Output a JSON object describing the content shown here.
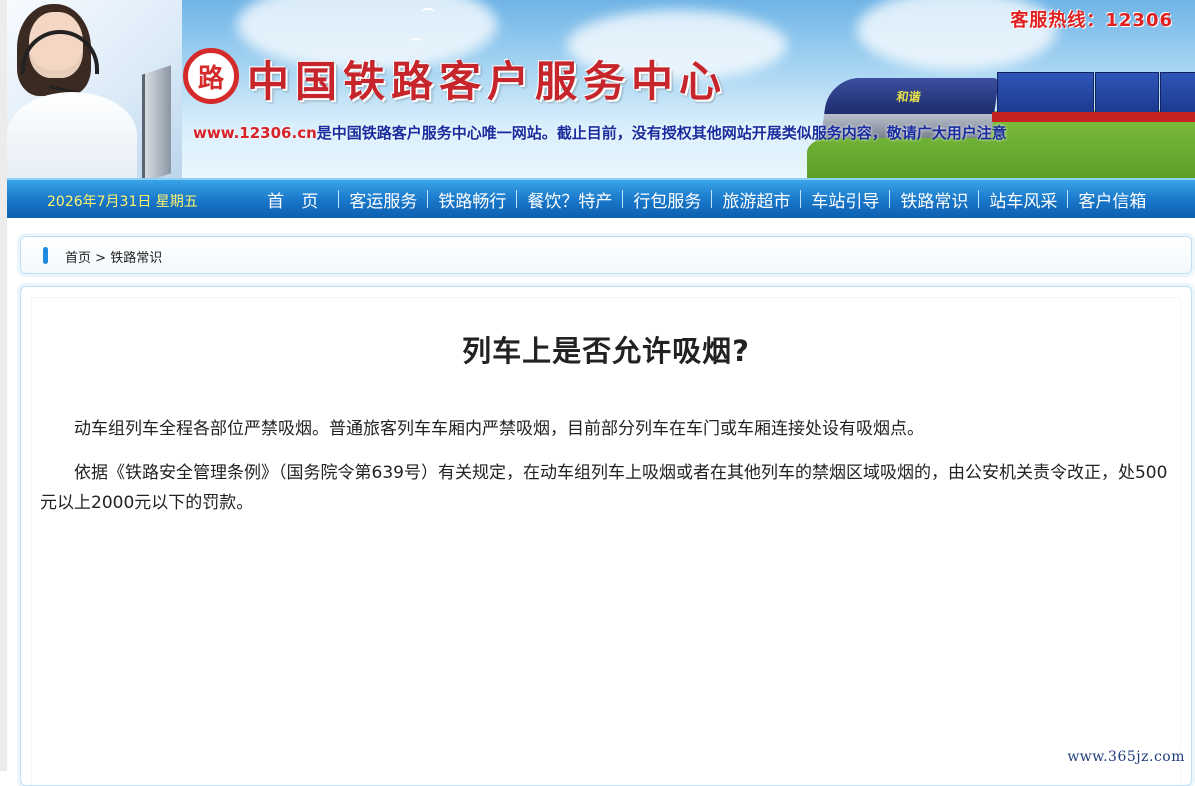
{
  "header": {
    "site_title": "中国铁路客户服务中心",
    "logo_glyph": "路",
    "hotline": "客服热线：12306",
    "notice_url": "www.12306.cn",
    "notice_text": "是中国铁路客户服务中心唯一网站。截止目前，没有授权其他网站开展类似服务内容，敬请广大用户注意"
  },
  "nav": {
    "date": "2026年7月31日 星期五",
    "items": [
      "首 页",
      "客运服务",
      "铁路畅行",
      "餐饮？特产",
      "行包服务",
      "旅游超市",
      "车站引导",
      "铁路常识",
      "站车风采",
      "客户信箱"
    ]
  },
  "breadcrumb": {
    "home": "首页",
    "separator": " > ",
    "current": "铁路常识"
  },
  "article": {
    "title": "列车上是否允许吸烟?",
    "paragraphs": [
      "动车组列车全程各部位严禁吸烟。普通旅客列车车厢内严禁吸烟，目前部分列车在车门或车厢连接处设有吸烟点。",
      "依据《铁路安全管理条例》（国务院令第639号）有关规定，在动车组列车上吸烟或者在其他列车的禁烟区域吸烟的，由公安机关责令改正，处500元以上2000元以下的罚款。"
    ]
  },
  "watermark": "www.365jz.com",
  "colors": {
    "title_red": "#c6262b",
    "nav_blue": "#1876c8",
    "date_yellow": "#fff36b",
    "notice_blue": "#1a2d9e"
  }
}
